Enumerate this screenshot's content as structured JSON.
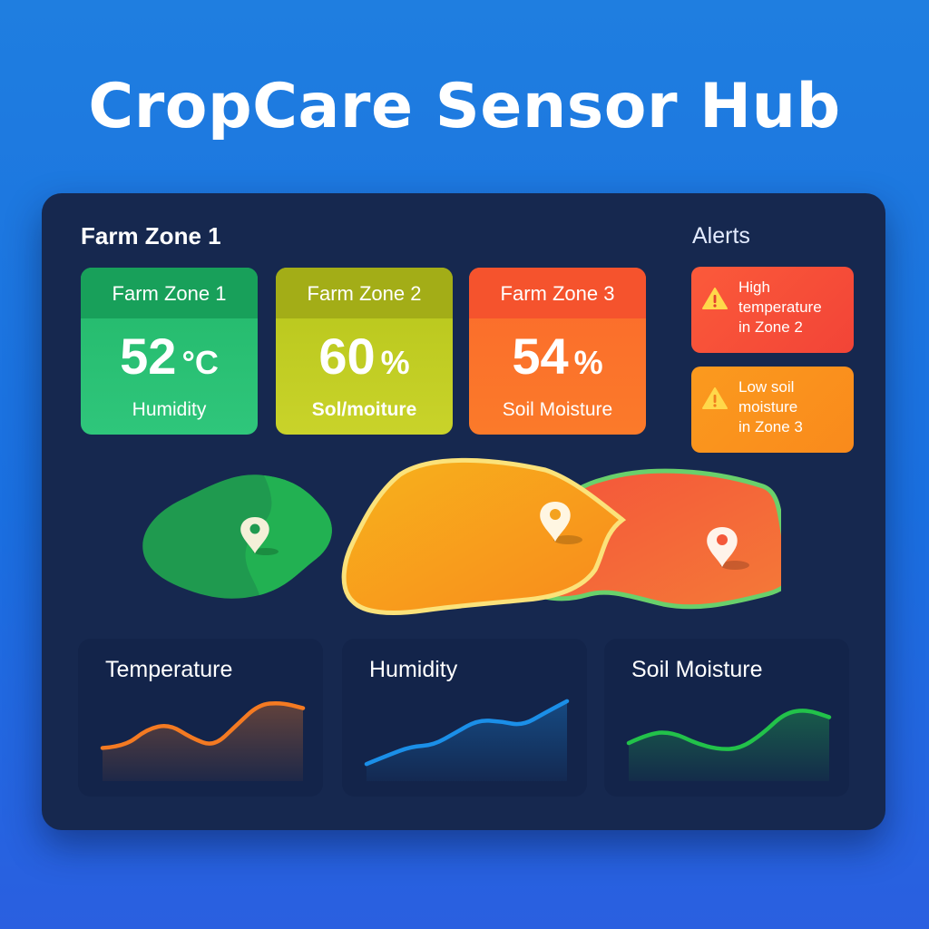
{
  "app": {
    "title": "CropCare Sensor Hub"
  },
  "dashboard": {
    "zone_heading": "Farm Zone 1",
    "alerts_heading": "Alerts"
  },
  "zones": [
    {
      "name": "Farm Zone 1",
      "value": "52",
      "unit": "°C",
      "label": "Humidity",
      "color": "#23b86a"
    },
    {
      "name": "Farm Zone 2",
      "value": "60",
      "unit": "%",
      "label": "Sol/moiture",
      "color": "#b6c51b"
    },
    {
      "name": "Farm Zone 3",
      "value": "54",
      "unit": "%",
      "label": "Soil Moisture",
      "color": "#fb6a2c"
    }
  ],
  "alerts": [
    {
      "lines": [
        "High",
        "temperature",
        "in Zone 2"
      ],
      "icon": "warning-icon",
      "color": "#f24437"
    },
    {
      "lines": [
        "Low soil",
        "moisture",
        "in Zone 3"
      ],
      "icon": "warning-icon",
      "color": "#f98a1c"
    }
  ],
  "map": {
    "regions": [
      {
        "zone": "Farm Zone 1",
        "color": "#1fa650",
        "icon": "map-pin-icon"
      },
      {
        "zone": "Farm Zone 2",
        "color": "#f9a21a",
        "icon": "map-pin-icon"
      },
      {
        "zone": "Farm Zone 3",
        "color": "#f4583a",
        "icon": "map-pin-icon"
      }
    ]
  },
  "charts": [
    {
      "title": "Temperature",
      "color": "#f47a22",
      "trend": [
        0.28,
        0.3,
        0.55,
        0.62,
        0.42,
        0.3,
        0.6,
        0.9,
        0.93,
        0.85
      ]
    },
    {
      "title": "Humidity",
      "color": "#1b8fe8",
      "trend": [
        0.05,
        0.18,
        0.3,
        0.32,
        0.5,
        0.68,
        0.66,
        0.6,
        0.78,
        0.95
      ]
    },
    {
      "title": "Soil Moisture",
      "color": "#22c24a",
      "trend": [
        0.35,
        0.5,
        0.5,
        0.35,
        0.26,
        0.27,
        0.48,
        0.78,
        0.83,
        0.72
      ]
    }
  ]
}
